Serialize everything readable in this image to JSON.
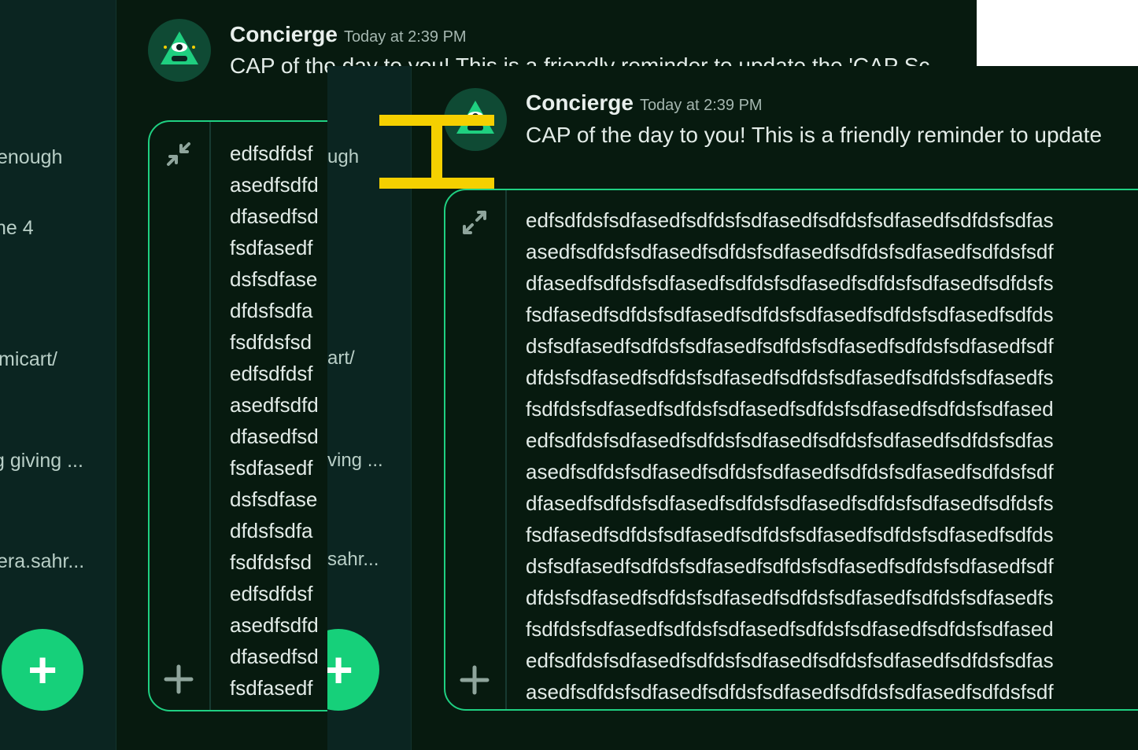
{
  "sidebar": {
    "items": [
      {
        "label": "enough"
      },
      {
        "label": "ne 4"
      },
      {
        "label": "micart/"
      },
      {
        "label": "g giving ..."
      },
      {
        "label": "era.sahr..."
      }
    ],
    "add_label": "+"
  },
  "front_sidebar": {
    "items": [
      {
        "label": "ugh"
      },
      {
        "label": "art/"
      },
      {
        "label": "ving ..."
      },
      {
        "label": "sahr..."
      }
    ],
    "add_label": "+"
  },
  "message": {
    "sender": "Concierge",
    "timestamp": "Today at 2:39 PM",
    "text": "CAP of the day to you! This is a friendly reminder to update the 'CAP Sc",
    "front_text": "CAP of the day to you! This is a friendly reminder to update"
  },
  "back_code": {
    "collapse_icon": "collapse-arrows-icon",
    "add_icon": "plus-icon",
    "lines": [
      "edfsdfdsf",
      "asedfsdfd",
      "dfasedfsd",
      "fsdfasedf",
      "dsfsdfase",
      "dfdsfsdfa",
      "fsdfdsfsd",
      "edfsdfdsf",
      "asedfsdfd",
      "dfasedfsd",
      "fsdfasedf",
      "dsfsdfase",
      "dfdsfsdfa",
      "fsdfdsfsd",
      "edfsdfdsf",
      "asedfsdfd",
      "dfasedfsd",
      "fsdfasedf"
    ]
  },
  "front_code": {
    "expand_icon": "expand-arrows-icon",
    "add_icon": "plus-icon",
    "lines": [
      "edfsdfdsfsdfasedfsdfdsfsdfasedfsdfdsfsdfasedfsdfdsfsdfas",
      "asedfsdfdsfsdfasedfsdfdsfsdfasedfsdfdsfsdfasedfsdfdsfsdf",
      "dfasedfsdfdsfsdfasedfsdfdsfsdfasedfsdfdsfsdfasedfsdfdsfs",
      "fsdfasedfsdfdsfsdfasedfsdfdsfsdfasedfsdfdsfsdfasedfsdfds",
      "dsfsdfasedfsdfdsfsdfasedfsdfdsfsdfasedfsdfdsfsdfasedfsdf",
      "dfdsfsdfasedfsdfdsfsdfasedfsdfdsfsdfasedfsdfdsfsdfasedfs",
      "fsdfdsfsdfasedfsdfdsfsdfasedfsdfdsfsdfasedfsdfdsfsdfased",
      "edfsdfdsfsdfasedfsdfdsfsdfasedfsdfdsfsdfasedfsdfdsfsdfas",
      "asedfsdfdsfsdfasedfsdfdsfsdfasedfsdfdsfsdfasedfsdfdsfsdf",
      "dfasedfsdfdsfsdfasedfsdfdsfsdfasedfsdfdsfsdfasedfsdfdsfs",
      "fsdfasedfsdfdsfsdfasedfsdfdsfsdfasedfsdfdsfsdfasedfsdfds",
      "dsfsdfasedfsdfdsfsdfasedfsdfdsfsdfasedfsdfdsfsdfasedfsdf",
      "dfdsfsdfasedfsdfdsfsdfasedfsdfdsfsdfasedfsdfdsfsdfasedfs",
      "fsdfdsfsdfasedfsdfdsfsdfasedfsdfdsfsdfasedfsdfdsfsdfased",
      "edfsdfdsfsdfasedfsdfdsfsdfasedfsdfdsfsdfasedfsdfdsfsdfas",
      "asedfsdfdsfsdfasedfsdfdsfsdfasedfsdfdsfsdfasedfsdfdsfsdf"
    ]
  },
  "colors": {
    "accent": "#16d07a",
    "border": "#1fd082",
    "background": "#071a0f",
    "sidebar": "#0b2521",
    "cursor": "#f5d000"
  },
  "cursor_icon": "text-cursor-icon"
}
